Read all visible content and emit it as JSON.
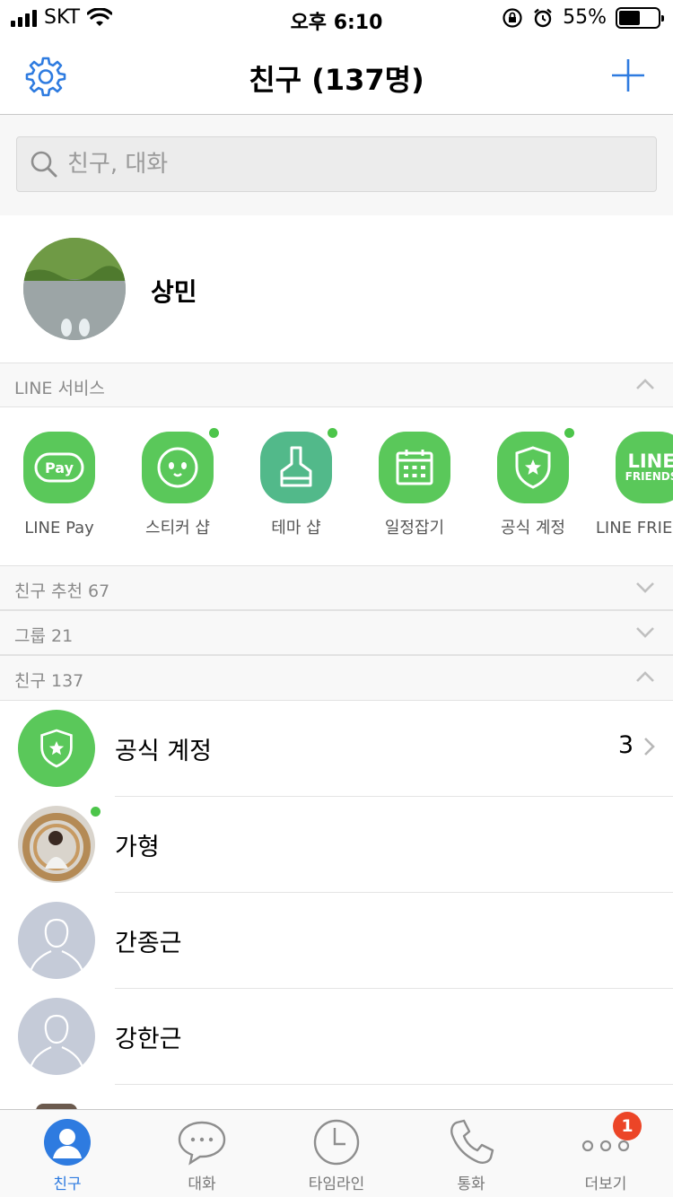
{
  "status_bar": {
    "carrier": "SKT",
    "time": "오후 6:10",
    "battery_percent": "55%",
    "battery_level": 0.55
  },
  "header": {
    "title": "친구 (137명)",
    "settings_icon": "gear-icon",
    "add_icon": "plus-icon"
  },
  "search": {
    "placeholder": "친구, 대화",
    "value": ""
  },
  "profile": {
    "name": "상민"
  },
  "sections": {
    "line_services": "LINE 서비스",
    "recommended": "친구 추천 67",
    "groups": "그룹 21",
    "friends": "친구 137"
  },
  "services": [
    {
      "label": "LINE Pay",
      "icon": "line-pay-icon",
      "icon_text": "Pay",
      "has_dot": false,
      "color": "#5ac85a"
    },
    {
      "label": "스티커 샵",
      "icon": "sticker-shop-icon",
      "has_dot": true,
      "color": "#5ac85a"
    },
    {
      "label": "테마 샵",
      "icon": "theme-shop-icon",
      "has_dot": true,
      "color": "#52b98a"
    },
    {
      "label": "일정잡기",
      "icon": "calendar-icon",
      "has_dot": false,
      "color": "#5ac85a"
    },
    {
      "label": "공식 계정",
      "icon": "official-account-icon",
      "has_dot": true,
      "color": "#5ac85a"
    },
    {
      "label": "LINE FRIENDS",
      "icon": "line-friends-icon",
      "icon_text_1": "LINE",
      "icon_text_2": "FRIENDS",
      "has_dot": false,
      "color": "#5ac85a"
    }
  ],
  "friends": [
    {
      "name": "공식 계정",
      "count": "3"
    },
    {
      "name": "가형"
    },
    {
      "name": "간종근"
    },
    {
      "name": "강한근"
    }
  ],
  "tabs": [
    {
      "label": "친구",
      "icon": "person-icon",
      "active": true
    },
    {
      "label": "대화",
      "icon": "chat-bubble-icon"
    },
    {
      "label": "타임라인",
      "icon": "clock-icon"
    },
    {
      "label": "통화",
      "icon": "phone-icon"
    },
    {
      "label": "더보기",
      "icon": "more-dots-icon",
      "badge": "1"
    }
  ],
  "colors": {
    "accent_blue": "#2e7be0",
    "line_green": "#5ac85a",
    "badge_red": "#ec4527",
    "online_dot": "#4cc54a"
  }
}
